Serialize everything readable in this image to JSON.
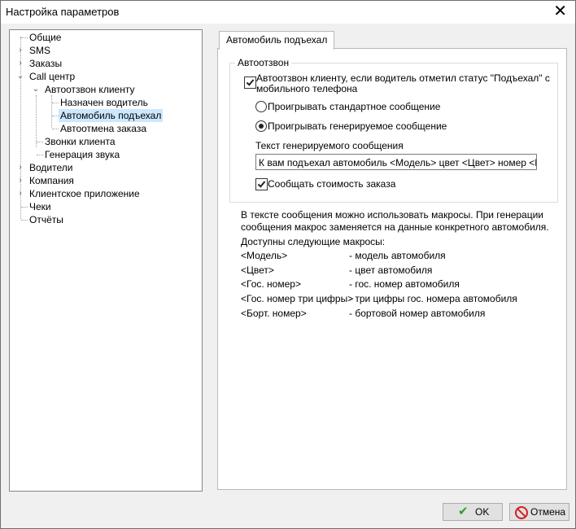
{
  "window": {
    "title": "Настройка параметров",
    "close_glyph": "✕"
  },
  "tree": {
    "nodes": [
      {
        "label": "Общие",
        "expander": ""
      },
      {
        "label": "SMS",
        "expander": "›"
      },
      {
        "label": "Заказы",
        "expander": "›"
      },
      {
        "label": "Call центр",
        "expander": "⌄"
      },
      {
        "label": "Автоотзвон клиенту",
        "expander": "⌄"
      },
      {
        "label": "Назначен водитель",
        "expander": ""
      },
      {
        "label": "Автомобиль подъехал",
        "expander": "",
        "selected": true
      },
      {
        "label": "Автоотмена заказа",
        "expander": ""
      },
      {
        "label": "Звонки клиента",
        "expander": ""
      },
      {
        "label": "Генерация звука",
        "expander": ""
      },
      {
        "label": "Водители",
        "expander": "›"
      },
      {
        "label": "Компания",
        "expander": "›"
      },
      {
        "label": "Клиентское приложение",
        "expander": "›"
      },
      {
        "label": "Чеки",
        "expander": ""
      },
      {
        "label": "Отчёты",
        "expander": ""
      }
    ]
  },
  "tab": {
    "label": "Автомобиль подъехал"
  },
  "autocall": {
    "legend": "Автоотзвон",
    "enable_checkbox": {
      "line1": "Автоотзвон клиенту, если водитель отметил статус \"Подъехал\" с",
      "line2": "мобильного телефона",
      "checked": true
    },
    "radio_standard": {
      "label": "Проигрывать стандартное сообщение",
      "selected": false
    },
    "radio_generated": {
      "label": "Проигрывать генерируемое сообщение",
      "selected": true
    },
    "message_label": "Текст генерируемого сообщения",
    "message_value": "К вам подъехал автомобиль <Модель> цвет <Цвет> номер <Гос. номер>",
    "price_checkbox": {
      "label": "Сообщать стоимость заказа",
      "checked": true
    }
  },
  "info": {
    "line1": "В тексте сообщения можно использовать макросы. При генерации",
    "line2": "сообщения макрос заменяется на данные конкретного автомобиля.",
    "line3": "Доступны следующие макросы:"
  },
  "macros": [
    {
      "name": "<Модель>",
      "desc": "- модель автомобиля"
    },
    {
      "name": "<Цвет>",
      "desc": "- цвет автомобиля"
    },
    {
      "name": "<Гос. номер>",
      "desc": "- гос. номер автомобиля"
    },
    {
      "name": "<Гос. номер три цифры>",
      "desc": "- три цифры гос. номера автомобиля"
    },
    {
      "name": "<Борт. номер>",
      "desc": "- бортовой номер автомобиля"
    }
  ],
  "buttons": {
    "ok": {
      "label": "OK",
      "icon": "check-icon",
      "color": "#2e9e2e"
    },
    "cancel": {
      "label": "Отмена",
      "icon": "cancel-icon",
      "color": "#d32020"
    }
  }
}
